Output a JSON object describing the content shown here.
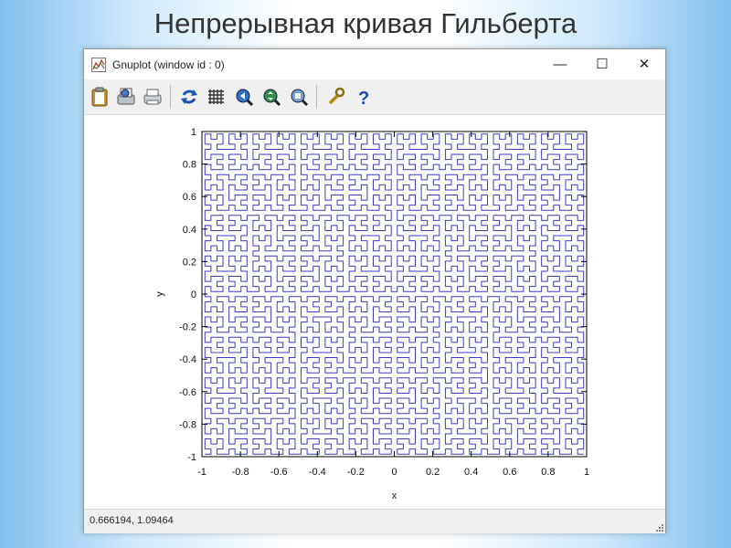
{
  "slide": {
    "title": "Непрерывная кривая Гильберта"
  },
  "window": {
    "title": "Gnuplot (window id : 0)",
    "controls": {
      "minimize": "—",
      "maximize": "☐",
      "close": "✕"
    }
  },
  "toolbar": {
    "buttons": [
      {
        "icon": "clipboard-icon"
      },
      {
        "icon": "print-preview-icon"
      },
      {
        "icon": "print-icon"
      },
      {
        "icon": "refresh-icon"
      },
      {
        "icon": "grid-icon"
      },
      {
        "icon": "zoom-previous-icon"
      },
      {
        "icon": "zoom-next-icon"
      },
      {
        "icon": "zoom-reset-icon"
      },
      {
        "icon": "settings-wrench-icon"
      },
      {
        "icon": "help-icon"
      }
    ]
  },
  "status": {
    "coordinates": "0.666194,  1.09464"
  },
  "chart_data": {
    "type": "line",
    "description_free": true,
    "curve": "hilbert",
    "hilbert_order": 6,
    "xlabel": "x",
    "ylabel": "y",
    "xlim": [
      -1,
      1
    ],
    "ylim": [
      -1,
      1
    ],
    "xticks": [
      "-1",
      "-0.8",
      "-0.6",
      "-0.4",
      "-0.2",
      "0",
      "0.2",
      "0.4",
      "0.6",
      "0.8",
      "1"
    ],
    "yticks": [
      "1",
      "0.8",
      "0.6",
      "0.4",
      "0.2",
      "0",
      "-0.2",
      "-0.4",
      "-0.6",
      "-0.8",
      "-1"
    ],
    "line_color": "#3c3cbe",
    "grid": false
  }
}
